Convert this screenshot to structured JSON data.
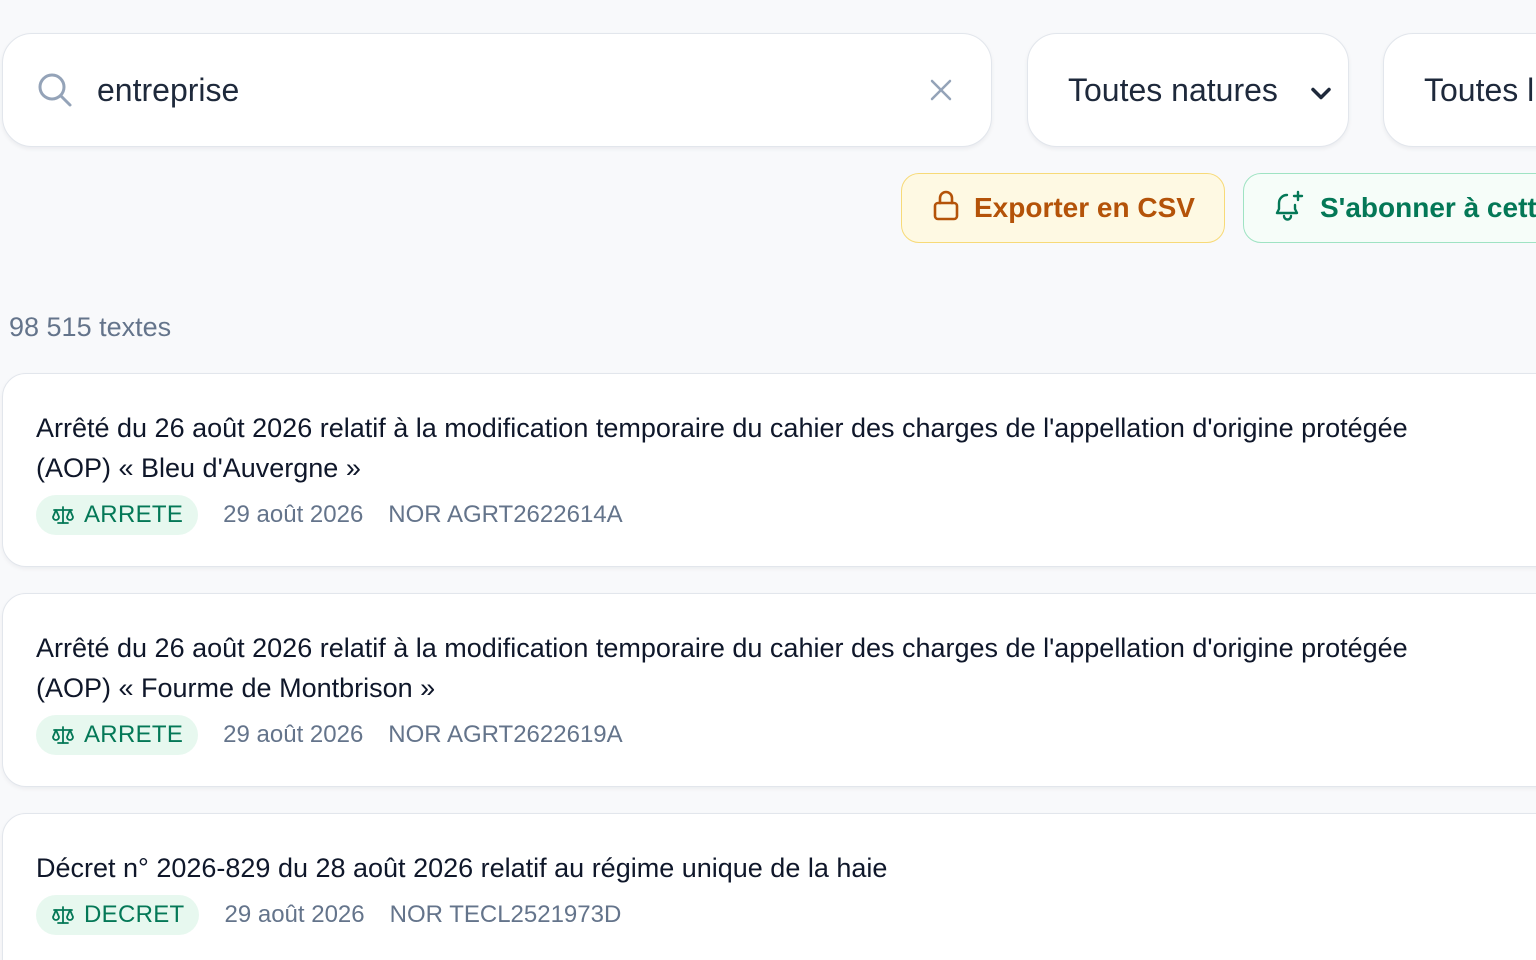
{
  "search": {
    "value": "entreprise",
    "icon": "search-icon",
    "clear_icon": "close-icon"
  },
  "filters": {
    "nature_selected": "Toutes natures",
    "second_selected": "Toutes l"
  },
  "actions": {
    "export_label": "Exporter en CSV",
    "export_icon": "lock-icon",
    "subscribe_label": "S'abonner à cett",
    "subscribe_icon": "bell-plus-icon"
  },
  "results": {
    "count_label": "98 515 textes",
    "items": [
      {
        "title_line1": "Arrêté du 26 août 2026 relatif à la modification temporaire du cahier des charges de l'appellation d'origine protégée",
        "title_line2": "(AOP) « Bleu d'Auvergne »",
        "type": "ARRETE",
        "date": "29 août 2026",
        "nor": "NOR AGRT2622614A"
      },
      {
        "title_line1": "Arrêté du 26 août 2026 relatif à la modification temporaire du cahier des charges de l'appellation d'origine protégée",
        "title_line2": "(AOP) « Fourme de Montbrison »",
        "type": "ARRETE",
        "date": "29 août 2026",
        "nor": "NOR AGRT2622619A"
      },
      {
        "title_line1": "Décret n° 2026-829 du 28 août 2026 relatif au régime unique de la haie",
        "type": "DECRET",
        "date": "29 août 2026",
        "nor": "NOR TECL2521973D"
      }
    ]
  },
  "colors": {
    "background": "#f8f9fb",
    "export_accent": "#b45309",
    "subscribe_accent": "#047857",
    "badge_bg": "#e7f8ef"
  }
}
